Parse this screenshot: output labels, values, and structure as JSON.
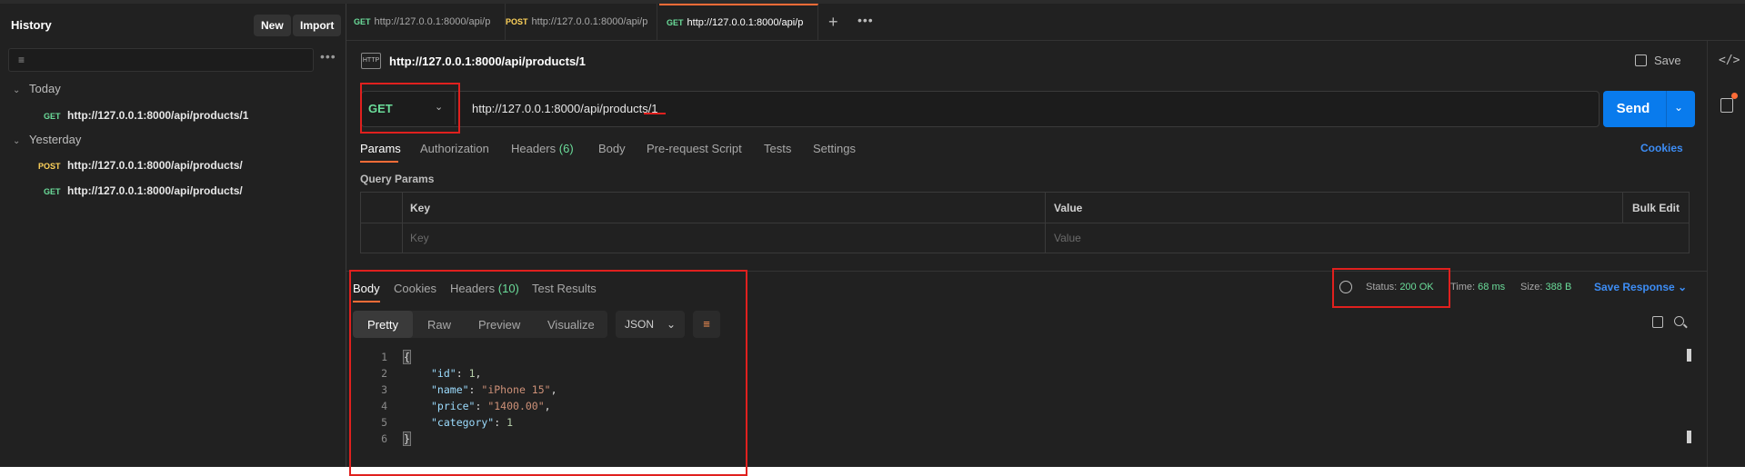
{
  "sidebar": {
    "title": "History",
    "new_label": "New",
    "import_label": "Import",
    "filter_icon": "filter-icon",
    "more_label": "•••",
    "groups": [
      {
        "label": "Today",
        "items": [
          {
            "method": "GET",
            "url": "http://127.0.0.1:8000/api/products/1"
          }
        ]
      },
      {
        "label": "Yesterday",
        "items": [
          {
            "method": "POST",
            "url": "http://127.0.0.1:8000/api/products/"
          },
          {
            "method": "GET",
            "url": "http://127.0.0.1:8000/api/products/"
          }
        ]
      }
    ]
  },
  "tabs": [
    {
      "method": "GET",
      "label": "http://127.0.0.1:8000/api/p"
    },
    {
      "method": "POST",
      "label": "http://127.0.0.1:8000/api/p"
    },
    {
      "method": "GET",
      "label": "http://127.0.0.1:8000/api/p"
    }
  ],
  "tab_plus": "+",
  "tab_more": "•••",
  "request": {
    "icon_text": "HTTP",
    "title": "http://127.0.0.1:8000/api/products/1",
    "save_label": "Save",
    "method": "GET",
    "url": "http://127.0.0.1:8000/api/products/1",
    "send_label": "Send",
    "tabs": [
      {
        "label": "Params"
      },
      {
        "label": "Authorization"
      },
      {
        "label": "Headers",
        "count": "(6)"
      },
      {
        "label": "Body"
      },
      {
        "label": "Pre-request Script"
      },
      {
        "label": "Tests"
      },
      {
        "label": "Settings"
      }
    ],
    "cookies_label": "Cookies",
    "query_params_title": "Query Params",
    "table": {
      "key_header": "Key",
      "value_header": "Value",
      "bulk_edit": "Bulk Edit",
      "key_placeholder": "Key",
      "value_placeholder": "Value"
    }
  },
  "response": {
    "tabs": [
      {
        "label": "Body"
      },
      {
        "label": "Cookies"
      },
      {
        "label": "Headers",
        "count": "(10)"
      },
      {
        "label": "Test Results"
      }
    ],
    "status_label": "Status:",
    "status_value": "200 OK",
    "time_label": "Time:",
    "time_value": "68 ms",
    "size_label": "Size:",
    "size_value": "388 B",
    "save_response": "Save Response",
    "formats": [
      "Pretty",
      "Raw",
      "Preview",
      "Visualize"
    ],
    "language": "JSON",
    "body_lines": [
      {
        "n": "1",
        "text": "{"
      },
      {
        "n": "2",
        "key": "\"id\"",
        "value": "1",
        "type": "num",
        "comma": ","
      },
      {
        "n": "3",
        "key": "\"name\"",
        "value": "\"iPhone 15\"",
        "type": "str",
        "comma": ","
      },
      {
        "n": "4",
        "key": "\"price\"",
        "value": "\"1400.00\"",
        "type": "str",
        "comma": ","
      },
      {
        "n": "5",
        "key": "\"category\"",
        "value": "1",
        "type": "num",
        "comma": ""
      },
      {
        "n": "6",
        "text": "}"
      }
    ]
  },
  "colors": {
    "get": "#6bdd9a",
    "post": "#ffd35b",
    "accent": "#ff6c37",
    "send": "#097bed",
    "annotation": "#e0201e"
  }
}
